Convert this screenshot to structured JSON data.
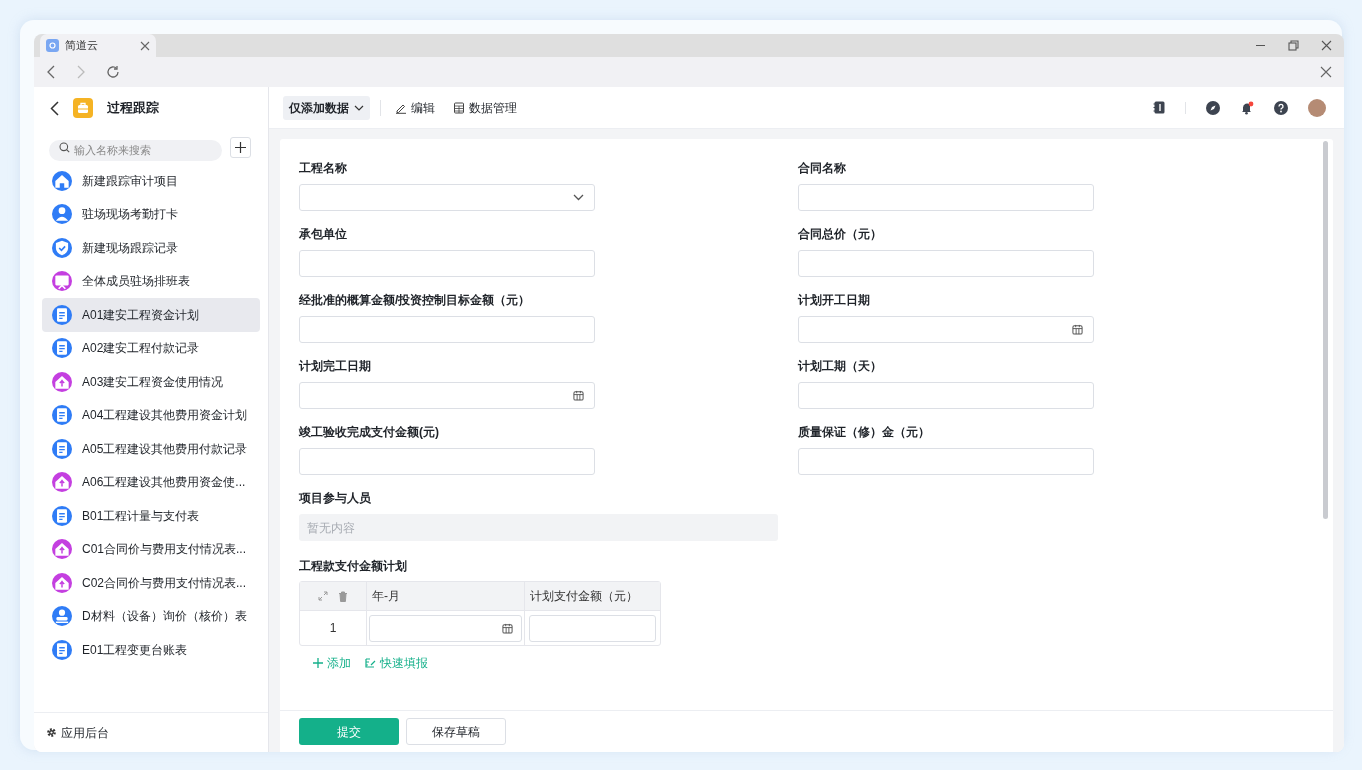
{
  "browser": {
    "tab_title": "简道云"
  },
  "app": {
    "title": "过程跟踪",
    "search_placeholder": "输入名称来搜索",
    "footer_link": "应用后台"
  },
  "sidebar": {
    "items": [
      {
        "label": "新建跟踪审计项目",
        "kind": "home",
        "color": "#2f7cf6",
        "selected": false
      },
      {
        "label": "驻场现场考勤打卡",
        "kind": "person",
        "color": "#2f7cf6",
        "selected": false
      },
      {
        "label": "新建现场跟踪记录",
        "kind": "shield",
        "color": "#2f7cf6",
        "selected": false
      },
      {
        "label": "全体成员驻场排班表",
        "kind": "board",
        "color": "#c43fe0",
        "selected": false
      },
      {
        "label": "A01建安工程资金计划",
        "kind": "doc",
        "color": "#2f7cf6",
        "selected": true
      },
      {
        "label": "A02建安工程付款记录",
        "kind": "doc",
        "color": "#2f7cf6",
        "selected": false
      },
      {
        "label": "A03建安工程资金使用情况",
        "kind": "house",
        "color": "#c43fe0",
        "selected": false
      },
      {
        "label": "A04工程建设其他费用资金计划",
        "kind": "doc",
        "color": "#2f7cf6",
        "selected": false
      },
      {
        "label": "A05工程建设其他费用付款记录",
        "kind": "doc",
        "color": "#2f7cf6",
        "selected": false
      },
      {
        "label": "A06工程建设其他费用资金使...",
        "kind": "house",
        "color": "#c43fe0",
        "selected": false
      },
      {
        "label": "B01工程计量与支付表",
        "kind": "doc",
        "color": "#2f7cf6",
        "selected": false
      },
      {
        "label": "C01合同价与费用支付情况表...",
        "kind": "house",
        "color": "#c43fe0",
        "selected": false
      },
      {
        "label": "C02合同价与费用支付情况表...",
        "kind": "house",
        "color": "#c43fe0",
        "selected": false
      },
      {
        "label": "D材料（设备）询价（核价）表",
        "kind": "stamp",
        "color": "#2f7cf6",
        "selected": false
      },
      {
        "label": "E01工程变更台账表",
        "kind": "doc",
        "color": "#2f7cf6",
        "selected": false
      }
    ]
  },
  "toolbar": {
    "mode": "仅添加数据",
    "edit": "编辑",
    "data_manage": "数据管理"
  },
  "form": {
    "fields": [
      {
        "label": "工程名称",
        "kind": "select"
      },
      {
        "label": "合同名称",
        "kind": "text"
      },
      {
        "label": "承包单位",
        "kind": "text"
      },
      {
        "label": "合同总价（元）",
        "kind": "text"
      },
      {
        "label": "经批准的概算金额/投资控制目标金额（元）",
        "kind": "text"
      },
      {
        "label": "计划开工日期",
        "kind": "date"
      },
      {
        "label": "计划完工日期",
        "kind": "date"
      },
      {
        "label": "计划工期（天）",
        "kind": "text"
      },
      {
        "label": "竣工验收完成支付金额(元)",
        "kind": "text"
      },
      {
        "label": "质量保证（修）金（元）",
        "kind": "text"
      }
    ],
    "members": {
      "label": "项目参与人员",
      "value": "暂无内容"
    },
    "subtable": {
      "label": "工程款支付金额计划",
      "columns": [
        "年-月",
        "计划支付金额（元）"
      ],
      "rows": [
        {
          "index": "1"
        }
      ],
      "add": "添加",
      "quick_fill": "快速填报"
    },
    "buttons": {
      "submit": "提交",
      "draft": "保存草稿"
    }
  }
}
